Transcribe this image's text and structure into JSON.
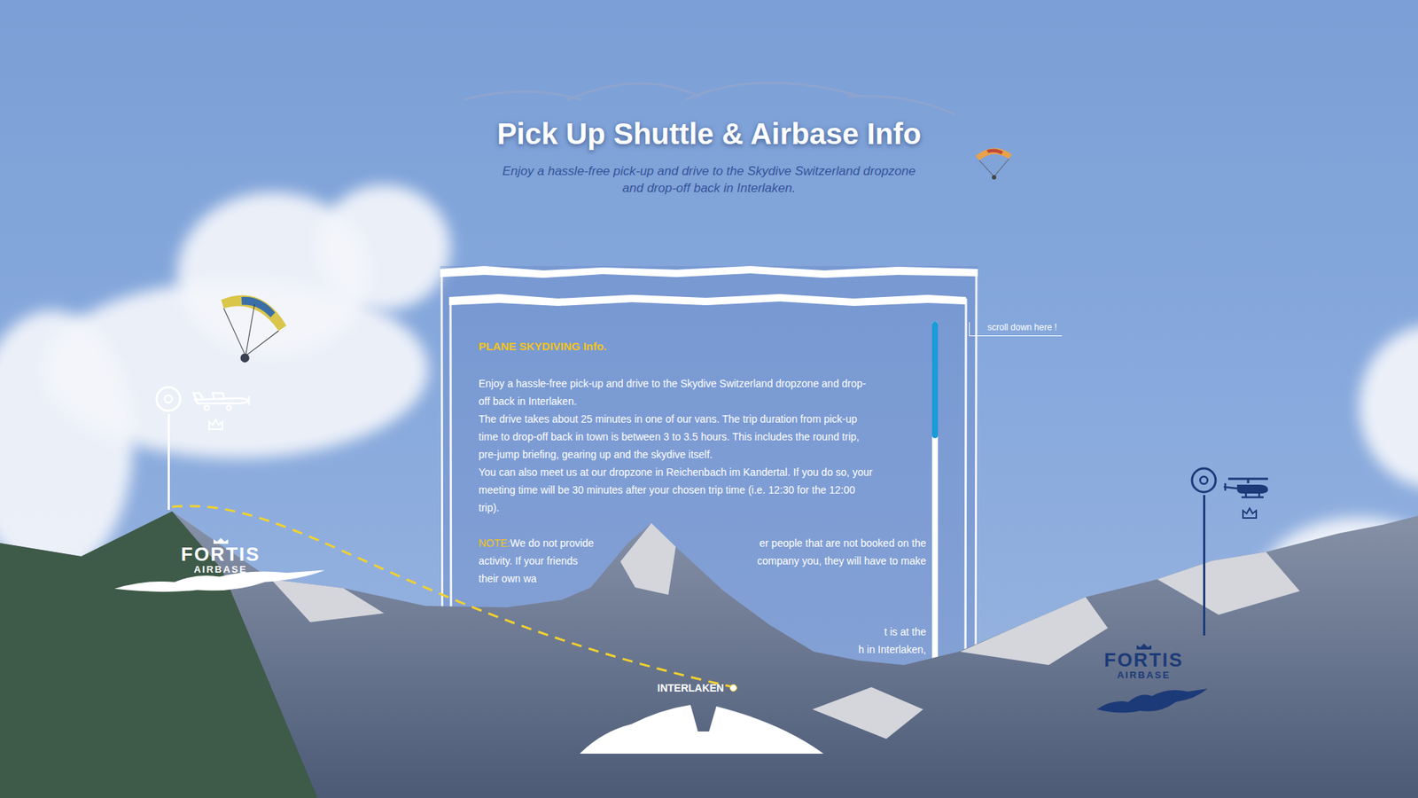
{
  "header": {
    "title": "Pick Up Shuttle & Airbase Info",
    "subtitle": [
      "Enjoy a hassle-free pick-up and drive to the Skydive Switzerland dropzone",
      "and drop-off back in Interlaken."
    ]
  },
  "panel": {
    "heading": "PLANE SKYDIVING Info.",
    "paragraphs": [
      [
        "Enjoy a hassle-free pick-up and drive to the Skydive Switzerland dropzone and drop-",
        "off back in Interlaken."
      ],
      [
        "The drive takes about 25 minutes in one of our vans. The trip duration from pick-up",
        "time to drop-off back in town is between 3 to 3.5 hours. This includes the round trip,",
        "pre-jump briefing, gearing up and the skydive itself."
      ],
      [
        "You can also meet us at our dropzone in Reichenbach im Kandertal. If you do so, your",
        "meeting time will be 30 minutes after your chosen trip time (i.e. 12:30 for the 12:00",
        "trip)."
      ]
    ],
    "note": {
      "label": "NOTE:",
      "lines": [
        {
          "left": "We do not provide",
          "right": "er people that are not booked on the"
        },
        {
          "left": "activity. If your friends",
          "right": "company you, they will have to make"
        },
        {
          "left": "their own wa"
        }
      ],
      "tail": [
        "t is at the",
        "h in Interlaken,"
      ]
    },
    "scroll": {
      "level": 0.28
    }
  },
  "scroll_hint": "scroll down here !",
  "map": {
    "airbases": [
      {
        "name": "FORTIS",
        "sub": "AIRBASE",
        "kind": "plane",
        "color": "#ffffff"
      },
      {
        "name": "FORTIS",
        "sub": "AIRBASE",
        "kind": "helicopter",
        "color": "#1c3a78"
      }
    ],
    "town": {
      "label": "INTERLAKEN"
    }
  }
}
